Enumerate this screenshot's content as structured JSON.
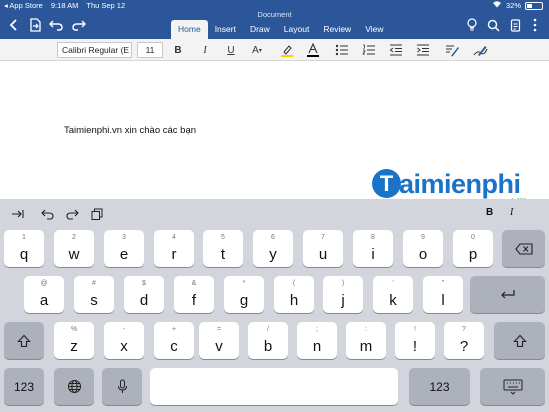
{
  "status_bar": {
    "back_app": "◂ App Store",
    "time": "9:18 AM",
    "date": "Thu Sep 12",
    "battery_percent": "32%",
    "battery_level": 0.32
  },
  "document_title": "Document",
  "tabs": [
    {
      "label": "Home",
      "active": true
    },
    {
      "label": "Insert",
      "active": false
    },
    {
      "label": "Draw",
      "active": false
    },
    {
      "label": "Layout",
      "active": false
    },
    {
      "label": "Review",
      "active": false
    },
    {
      "label": "View",
      "active": false
    }
  ],
  "ribbon": {
    "font_name": "Calibri Regular (E",
    "font_size": "11",
    "bold": "B",
    "italic": "I",
    "underline": "U",
    "font_color_letter": "A"
  },
  "document": {
    "body_text": "Taimienphi.vn xin chào các bạn"
  },
  "watermark": {
    "initial": "T",
    "text": "aimienphi",
    "suffix": ".vn"
  },
  "keyboard": {
    "toolbar_bold": "B",
    "toolbar_italic": "I",
    "row1": [
      {
        "sub": "1",
        "main": "q"
      },
      {
        "sub": "2",
        "main": "w"
      },
      {
        "sub": "3",
        "main": "e"
      },
      {
        "sub": "4",
        "main": "r"
      },
      {
        "sub": "5",
        "main": "t"
      },
      {
        "sub": "6",
        "main": "y"
      },
      {
        "sub": "7",
        "main": "u"
      },
      {
        "sub": "8",
        "main": "i"
      },
      {
        "sub": "9",
        "main": "o"
      },
      {
        "sub": "0",
        "main": "p"
      }
    ],
    "row2": [
      {
        "sub": "@",
        "main": "a"
      },
      {
        "sub": "#",
        "main": "s"
      },
      {
        "sub": "$",
        "main": "d"
      },
      {
        "sub": "&",
        "main": "f"
      },
      {
        "sub": "*",
        "main": "g"
      },
      {
        "sub": "(",
        "main": "h"
      },
      {
        "sub": ")",
        "main": "j"
      },
      {
        "sub": "'",
        "main": "k"
      },
      {
        "sub": "\"",
        "main": "l"
      }
    ],
    "row3": [
      {
        "sub": "%",
        "main": "z"
      },
      {
        "sub": "-",
        "main": "x"
      },
      {
        "sub": "+",
        "main": "c"
      },
      {
        "sub": "=",
        "main": "v"
      },
      {
        "sub": "/",
        "main": "b"
      },
      {
        "sub": ";",
        "main": "n"
      },
      {
        "sub": ":",
        "main": "m"
      },
      {
        "sub": "!",
        "main": "!"
      },
      {
        "sub": "?",
        "main": "?"
      }
    ],
    "numbers_key_left": "123",
    "numbers_key_right": "123"
  },
  "colors": {
    "title_bar": "#2b579a",
    "ribbon": "#f3f3f3",
    "keyboard_bg": "#d3d5dc",
    "key": "#ffffff",
    "key_dark": "#acb1bb",
    "font_color_swatch": "#000000",
    "highlight_swatch": "#f5d400"
  },
  "icons": [
    "back-icon",
    "file-icon",
    "undo-icon",
    "redo-icon",
    "lightbulb-icon",
    "search-icon",
    "share-icon",
    "more-icon",
    "highlighter-icon",
    "bullets-icon",
    "numbering-icon",
    "outdent-icon",
    "indent-icon",
    "styles-icon",
    "draw-pen-icon",
    "tab-key-icon",
    "keyboard-undo-icon",
    "keyboard-redo-icon",
    "paste-icon",
    "delete-icon",
    "return-icon",
    "shift-icon",
    "globe-icon",
    "microphone-icon",
    "dismiss-keyboard-icon"
  ]
}
